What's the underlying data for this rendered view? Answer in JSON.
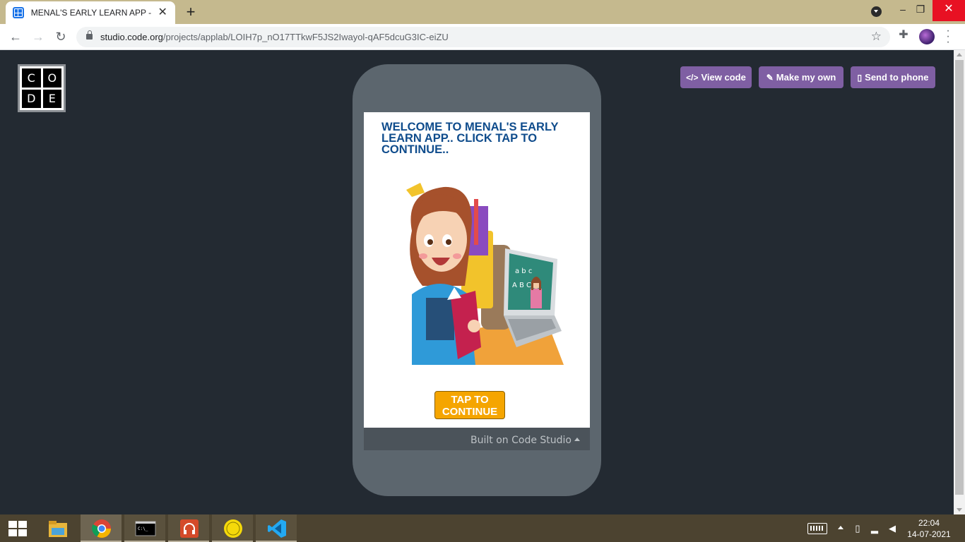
{
  "browser": {
    "tab_title": "MENAL'S EARLY LEARN APP - App Lab",
    "url_host": "studio.code.org",
    "url_path": "/projects/applab/LOIH7p_nO17TTkwF5JS2Iwayol-qAF5dcuG3IC-eiZU"
  },
  "header": {
    "logo_letters": [
      "C",
      "O",
      "D",
      "E"
    ],
    "view_code_label": "View code",
    "make_my_own_label": "Make my own",
    "send_to_phone_label": "Send to phone"
  },
  "app": {
    "welcome_text": "WELCOME TO MENAL'S EARLY LEARN APP.. CLICK TAP TO CONTINUE..",
    "tap_button_label": "TAP TO CONTINUE",
    "built_on_label": "Built on Code Studio"
  },
  "illustration": {
    "board_text_1": "a b c",
    "board_text_2": "A B C"
  },
  "taskbar": {
    "time": "22:04",
    "date": "14-07-2021"
  },
  "colors": {
    "page_bg": "#232a32",
    "button_purple": "#7f5fa3",
    "welcome_blue": "#0f4c8c",
    "tap_orange": "#f5a500"
  }
}
